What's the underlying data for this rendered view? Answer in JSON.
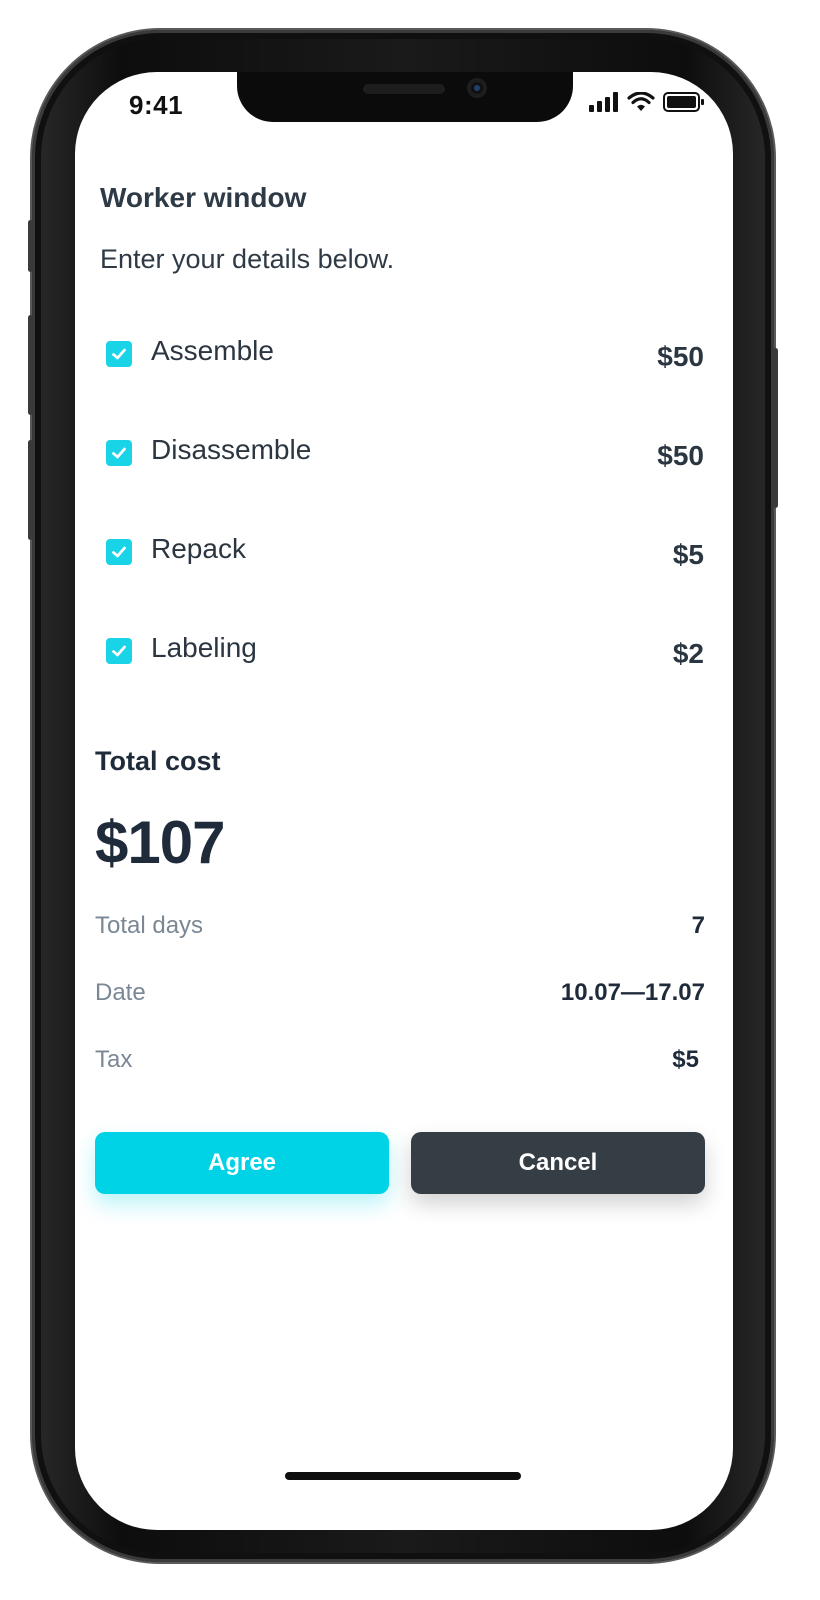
{
  "status_bar": {
    "time": "9:41"
  },
  "header": {
    "title": "Worker window",
    "subtitle": "Enter your details below."
  },
  "services": [
    {
      "label": "Assemble",
      "price": "$50",
      "checked": true
    },
    {
      "label": "Disassemble",
      "price": "$50",
      "checked": true
    },
    {
      "label": "Repack",
      "price": "$5",
      "checked": true
    },
    {
      "label": "Labeling",
      "price": "$2",
      "checked": true
    }
  ],
  "summary": {
    "total_label": "Total cost",
    "total_value": "$107",
    "details": [
      {
        "label": "Total days",
        "value": "7"
      },
      {
        "label": "Date",
        "value": "10.07—17.07"
      },
      {
        "label": "Tax",
        "value": "$5"
      }
    ]
  },
  "actions": {
    "agree_label": "Agree",
    "cancel_label": "Cancel"
  },
  "colors": {
    "accent": "#00d3e6",
    "dark_button": "#353d45",
    "text_dark": "#1f2b3a",
    "text_muted": "#7a8794"
  }
}
